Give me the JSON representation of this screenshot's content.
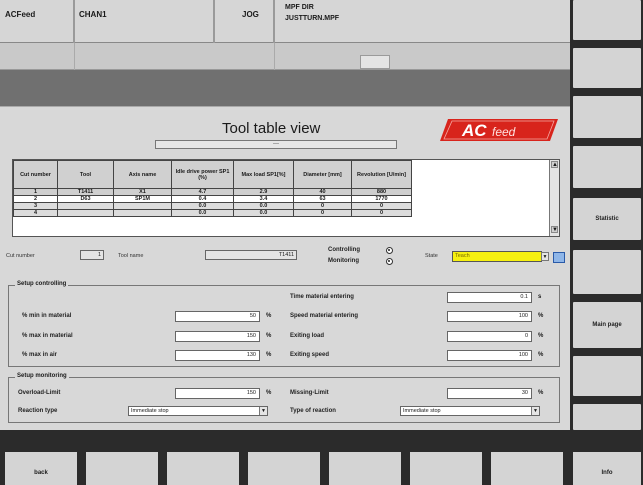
{
  "header": {
    "product": "ACFeed",
    "channel": "CHAN1",
    "mode": "JOG",
    "program_dir": "MPF DIR",
    "program_file": "JUSTTURN.MPF"
  },
  "page": {
    "title": "Tool table view",
    "logo_text": "ACfeed",
    "tool_selector_value": "---"
  },
  "tool_table": {
    "columns": [
      "Cut number",
      "Tool",
      "Axis name",
      "Idle drive power SP1 (%)",
      "Max load SP1[%]",
      "Diameter [mm]",
      "Revolution [U/min]"
    ],
    "rows": [
      [
        "1",
        "T1411",
        "X1",
        "4.7",
        "2.9",
        "40",
        "880"
      ],
      [
        "2",
        "D63",
        "SP1M",
        "0.4",
        "3.4",
        "63",
        "1770"
      ],
      [
        "3",
        "",
        "",
        "0.0",
        "0.0",
        "0",
        "0"
      ],
      [
        "4",
        "",
        "",
        "0.0",
        "0.0",
        "0",
        "0"
      ]
    ]
  },
  "cut_row": {
    "cut_number_label": "Cut number",
    "cut_number_value": "1",
    "tool_name_label": "Tool name",
    "tool_name_value": "T1411",
    "controlling_label": "Controlling",
    "monitoring_label": "Monitoring",
    "state_label": "State",
    "state_value": "Teach"
  },
  "setup_controlling": {
    "title": "Setup controlling",
    "left": [
      {
        "label": "% min in material",
        "value": "50",
        "unit": "%"
      },
      {
        "label": "% max in material",
        "value": "150",
        "unit": "%"
      },
      {
        "label": "% max in air",
        "value": "130",
        "unit": "%"
      }
    ],
    "right": [
      {
        "label": "Time material entering",
        "value": "0.1",
        "unit": "s"
      },
      {
        "label": "Speed material entering",
        "value": "100",
        "unit": "%"
      },
      {
        "label": "Exiting load",
        "value": "0",
        "unit": "%"
      },
      {
        "label": "Exiting speed",
        "value": "100",
        "unit": "%"
      }
    ]
  },
  "setup_monitoring": {
    "title": "Setup monitoring",
    "overload_label": "Overload-Limit",
    "overload_value": "150",
    "overload_unit": "%",
    "missing_label": "Missing-Limit",
    "missing_value": "30",
    "missing_unit": "%",
    "reaction_label": "Reaction type",
    "reaction_value": "Immediate stop",
    "type_reaction_label": "Type of reaction",
    "type_reaction_value": "Immediate stop"
  },
  "softkeys_vertical": [
    "",
    "",
    "",
    "",
    "Statistic",
    "",
    "Main page",
    "",
    ""
  ],
  "softkeys_horizontal": [
    "back",
    "",
    "",
    "",
    "",
    "",
    "",
    "Info"
  ]
}
